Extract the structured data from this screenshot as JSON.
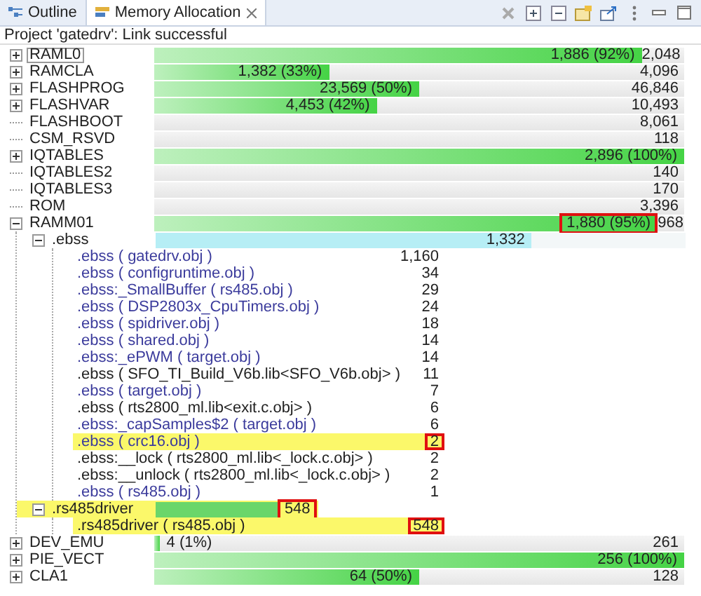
{
  "tabs": [
    {
      "label": "Outline",
      "selected": false,
      "closable": false
    },
    {
      "label": "Memory Allocation",
      "selected": true,
      "closable": true
    }
  ],
  "status": "Project 'gatedrv': Link successful",
  "regions": [
    {
      "name": "RAML0",
      "expandable": true,
      "expanded": false,
      "focused": true,
      "level": 0.92,
      "used": "1,886 (92%)",
      "total": "2,048"
    },
    {
      "name": "RAMCLA",
      "expandable": true,
      "expanded": false,
      "focused": false,
      "level": 0.33,
      "used": "1,382 (33%)",
      "total": "4,096"
    },
    {
      "name": "FLASHPROG",
      "expandable": true,
      "expanded": false,
      "focused": false,
      "level": 0.5,
      "used": "23,569 (50%)",
      "total": "46,846"
    },
    {
      "name": "FLASHVAR",
      "expandable": true,
      "expanded": false,
      "focused": false,
      "level": 0.42,
      "used": "4,453 (42%)",
      "total": "10,493"
    },
    {
      "name": "FLASHBOOT",
      "expandable": false,
      "focused": false,
      "total": "8,061"
    },
    {
      "name": "CSM_RSVD",
      "expandable": false,
      "focused": false,
      "total": "118"
    },
    {
      "name": "IQTABLES",
      "expandable": true,
      "expanded": false,
      "focused": false,
      "level": 1,
      "used": "2,896 (100%)"
    },
    {
      "name": "IQTABLES2",
      "expandable": false,
      "focused": false,
      "total": "140"
    },
    {
      "name": "IQTABLES3",
      "expandable": false,
      "focused": false,
      "total": "170"
    },
    {
      "name": "ROM",
      "expandable": false,
      "focused": false,
      "total": "3,396"
    },
    {
      "name": "RAMM01",
      "expandable": true,
      "expanded": true,
      "focused": false,
      "level": 0.95,
      "used": "1,880 (95%)",
      "used_boxed": true,
      "total": "968",
      "sections": [
        {
          "name": ".ebss",
          "expanded": true,
          "highlighted": false,
          "level": 0.71,
          "color": "#b6eef5",
          "value": "1,332",
          "boxed": false,
          "objects": [
            {
              "name": ".ebss ( gatedrv.obj )",
              "value": "1,160",
              "kind": "project",
              "highlighted": false,
              "boxed": false
            },
            {
              "name": ".ebss ( configruntime.obj )",
              "value": "34",
              "kind": "project",
              "highlighted": false,
              "boxed": false
            },
            {
              "name": ".ebss:_SmallBuffer ( rs485.obj )",
              "value": "29",
              "kind": "project",
              "highlighted": false,
              "boxed": false
            },
            {
              "name": ".ebss ( DSP2803x_CpuTimers.obj )",
              "value": "24",
              "kind": "project",
              "highlighted": false,
              "boxed": false
            },
            {
              "name": ".ebss ( spidriver.obj )",
              "value": "18",
              "kind": "project",
              "highlighted": false,
              "boxed": false
            },
            {
              "name": ".ebss ( shared.obj )",
              "value": "14",
              "kind": "project",
              "highlighted": false,
              "boxed": false
            },
            {
              "name": ".ebss:_ePWM ( target.obj )",
              "value": "14",
              "kind": "project",
              "highlighted": false,
              "boxed": false
            },
            {
              "name": ".ebss ( SFO_TI_Build_V6b.lib<SFO_V6b.obj> )",
              "value": "11",
              "kind": "library",
              "highlighted": false,
              "boxed": false
            },
            {
              "name": ".ebss ( target.obj )",
              "value": "7",
              "kind": "project",
              "highlighted": false,
              "boxed": false
            },
            {
              "name": ".ebss ( rts2800_ml.lib<exit.c.obj> )",
              "value": "6",
              "kind": "library",
              "highlighted": false,
              "boxed": false
            },
            {
              "name": ".ebss:_capSamples$2 ( target.obj )",
              "value": "6",
              "kind": "project",
              "highlighted": false,
              "boxed": false
            },
            {
              "name": ".ebss ( crc16.obj )",
              "value": "2",
              "kind": "project",
              "highlighted": true,
              "boxed": true
            },
            {
              "name": ".ebss:__lock ( rts2800_ml.lib<_lock.c.obj> )",
              "value": "2",
              "kind": "library",
              "highlighted": false,
              "boxed": false
            },
            {
              "name": ".ebss:__unlock ( rts2800_ml.lib<_lock.c.obj> )",
              "value": "2",
              "kind": "library",
              "highlighted": false,
              "boxed": false
            },
            {
              "name": ".ebss ( rs485.obj )",
              "value": "1",
              "kind": "project",
              "highlighted": false,
              "boxed": false
            }
          ]
        },
        {
          "name": ".rs485driver",
          "expanded": true,
          "highlighted": true,
          "level": 0.23,
          "color": "#6ad66a",
          "value": "548",
          "boxed": true,
          "objects": [
            {
              "name": ".rs485driver ( rs485.obj )",
              "value": "548",
              "kind": "library",
              "highlighted": true,
              "boxed": true
            }
          ]
        }
      ]
    },
    {
      "name": "DEV_EMU",
      "expandable": true,
      "expanded": false,
      "focused": false,
      "level": 0.01,
      "used": "4 (1%)",
      "total": "261"
    },
    {
      "name": "PIE_VECT",
      "expandable": true,
      "expanded": false,
      "focused": false,
      "level": 1,
      "used": "256 (100%)"
    },
    {
      "name": "CLA1",
      "expandable": true,
      "expanded": false,
      "focused": false,
      "level": 0.5,
      "used": "64 (50%)",
      "total": "128"
    }
  ]
}
